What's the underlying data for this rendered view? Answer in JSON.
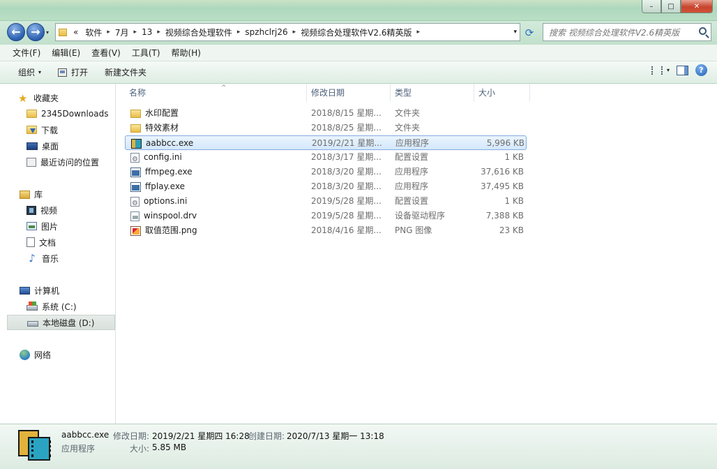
{
  "titlebar": {
    "min_icon": "–",
    "max_icon": "□",
    "close_icon": "✕"
  },
  "nav": {
    "back_icon": "←",
    "forward_icon": "→",
    "dropdown_icon": "▾"
  },
  "address": {
    "overflow": "«",
    "crumbs": [
      "软件",
      "7月",
      "13",
      "视频综合处理软件",
      "spzhclrj26",
      "视频综合处理软件V2.6精英版"
    ],
    "separator": "▸",
    "dropdown_icon": "▾",
    "refresh_icon": "⟳"
  },
  "search": {
    "placeholder": "搜索 视频综合处理软件V2.6精英版"
  },
  "menu": [
    "文件(F)",
    "编辑(E)",
    "查看(V)",
    "工具(T)",
    "帮助(H)"
  ],
  "toolbar": {
    "organize": "组织",
    "open": "打开",
    "new_folder": "新建文件夹",
    "dropdown_icon": "▾"
  },
  "sidebar": {
    "favorites": {
      "label": "收藏夹",
      "items": [
        "2345Downloads",
        "下载",
        "桌面",
        "最近访问的位置"
      ]
    },
    "libraries": {
      "label": "库",
      "items": [
        "视频",
        "图片",
        "文档",
        "音乐"
      ]
    },
    "computer": {
      "label": "计算机",
      "items": [
        "系统 (C:)",
        "本地磁盘 (D:)"
      ]
    },
    "network": {
      "label": "网络"
    }
  },
  "columns": {
    "name": "名称",
    "date": "修改日期",
    "type": "类型",
    "size": "大小",
    "sort_icon": "^"
  },
  "files": [
    {
      "name": "水印配置",
      "date": "2018/8/15 星期...",
      "type": "文件夹",
      "size": "",
      "icon": "folder-icon"
    },
    {
      "name": "特效素材",
      "date": "2018/8/25 星期...",
      "type": "文件夹",
      "size": "",
      "icon": "folder-icon"
    },
    {
      "name": "aabbcc.exe",
      "date": "2019/2/21 星期...",
      "type": "应用程序",
      "size": "5,996 KB",
      "icon": "app-icon"
    },
    {
      "name": "config.ini",
      "date": "2018/3/17 星期...",
      "type": "配置设置",
      "size": "1 KB",
      "icon": "ini-icon"
    },
    {
      "name": "ffmpeg.exe",
      "date": "2018/3/20 星期...",
      "type": "应用程序",
      "size": "37,616 KB",
      "icon": "exe-icon"
    },
    {
      "name": "ffplay.exe",
      "date": "2018/3/20 星期...",
      "type": "应用程序",
      "size": "37,495 KB",
      "icon": "exe-icon"
    },
    {
      "name": "options.ini",
      "date": "2019/5/28 星期...",
      "type": "配置设置",
      "size": "1 KB",
      "icon": "ini-icon"
    },
    {
      "name": "winspool.drv",
      "date": "2019/5/28 星期...",
      "type": "设备驱动程序",
      "size": "7,388 KB",
      "icon": "drv-icon"
    },
    {
      "name": "取值范围.png",
      "date": "2018/4/16 星期...",
      "type": "PNG 图像",
      "size": "23 KB",
      "icon": "png-icon"
    }
  ],
  "details": {
    "name": "aabbcc.exe",
    "type": "应用程序",
    "modified_label": "修改日期:",
    "modified": "2019/2/21 星期四 16:28",
    "created_label": "创建日期:",
    "created": "2020/7/13 星期一 13:18",
    "size_label": "大小:",
    "size": "5.85 MB"
  },
  "help_icon": "?"
}
